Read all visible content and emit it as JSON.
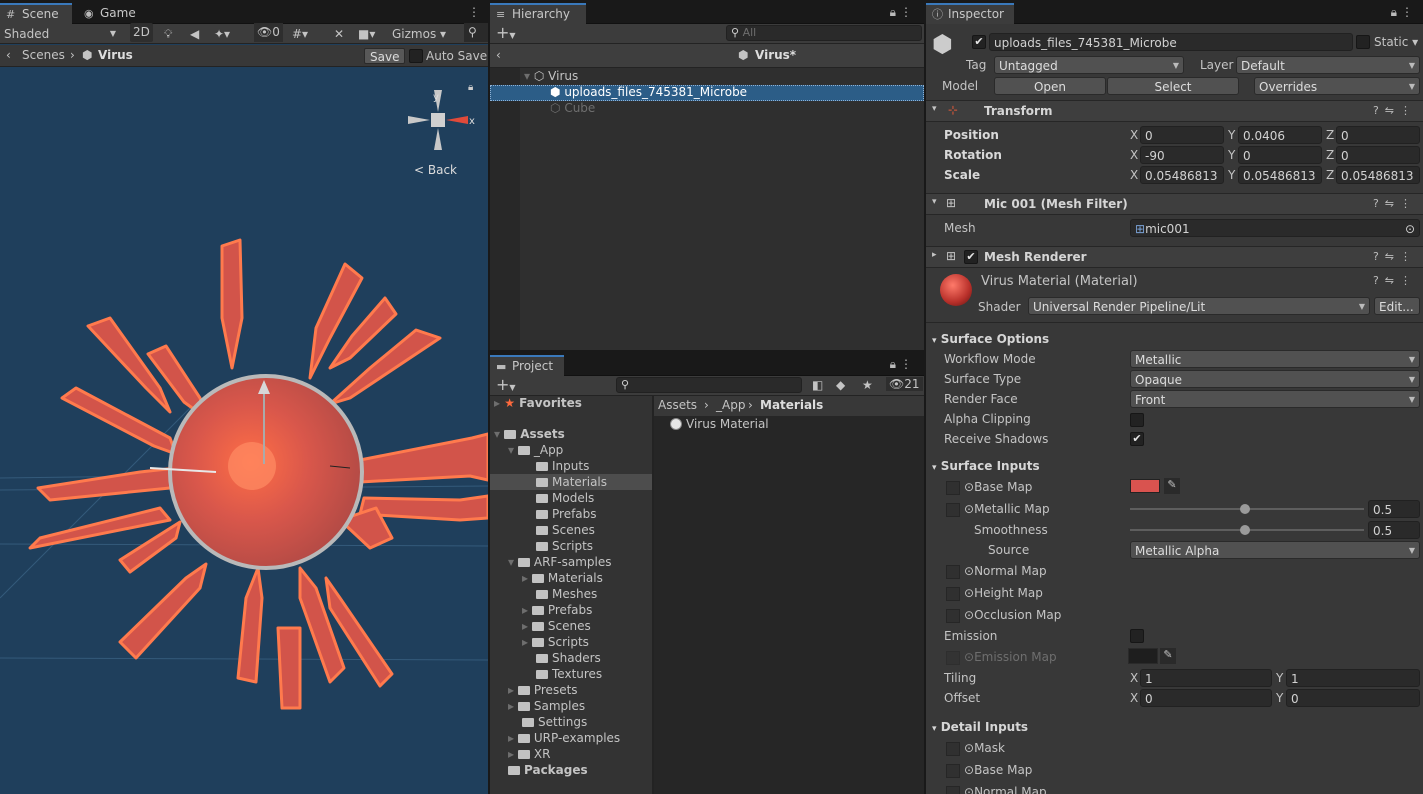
{
  "scene": {
    "tabs": [
      "Scene",
      "Game"
    ],
    "shading": "Shaded",
    "mode_2d": "2D",
    "hidden_count": "0",
    "gizmos": "Gizmos",
    "breadcrumb_root": "Scenes",
    "breadcrumb_current": "Virus",
    "save_label": "Save",
    "autosave_label": "Auto Save",
    "gizmo_back": "< Back",
    "axis_y": "y",
    "axis_x": "x",
    "colors": {
      "sky": "#1f3f5c",
      "virus": "#e2574c",
      "outline": "#ff6a3d"
    }
  },
  "hierarchy": {
    "tab": "Hierarchy",
    "add_label": "+",
    "search_placeholder": "All",
    "scene_title": "Virus*",
    "items": [
      {
        "label": "Virus"
      },
      {
        "label": "uploads_files_745381_Microbe"
      },
      {
        "label": "Cube"
      }
    ]
  },
  "project": {
    "tab": "Project",
    "hidden_count": "21",
    "favorites": "Favorites",
    "assets": "Assets",
    "tree": [
      {
        "label": "_App"
      },
      {
        "label": "Inputs"
      },
      {
        "label": "Materials"
      },
      {
        "label": "Models"
      },
      {
        "label": "Prefabs"
      },
      {
        "label": "Scenes"
      },
      {
        "label": "Scripts"
      },
      {
        "label": "ARF-samples"
      },
      {
        "label": "Materials"
      },
      {
        "label": "Meshes"
      },
      {
        "label": "Prefabs"
      },
      {
        "label": "Scenes"
      },
      {
        "label": "Scripts"
      },
      {
        "label": "Shaders"
      },
      {
        "label": "Textures"
      },
      {
        "label": "Presets"
      },
      {
        "label": "Samples"
      },
      {
        "label": "Settings"
      },
      {
        "label": "URP-examples"
      },
      {
        "label": "XR"
      }
    ],
    "packages": "Packages",
    "path": [
      "Assets",
      "_App",
      "Materials"
    ],
    "files": [
      {
        "label": "Virus Material"
      }
    ]
  },
  "inspector": {
    "tab": "Inspector",
    "object_name": "uploads_files_745381_Microbe",
    "static_label": "Static",
    "tag_label": "Tag",
    "tag_value": "Untagged",
    "layer_label": "Layer",
    "layer_value": "Default",
    "model_label": "Model",
    "open_label": "Open",
    "select_label": "Select",
    "overrides_label": "Overrides",
    "transform": {
      "title": "Transform",
      "position_label": "Position",
      "rotation_label": "Rotation",
      "scale_label": "Scale",
      "position": [
        "0",
        "0.0406",
        "0"
      ],
      "rotation": [
        "-90",
        "0",
        "0"
      ],
      "scale": [
        "0.05486813",
        "0.05486813",
        "0.05486813"
      ]
    },
    "mesh_filter": {
      "title": "Mic 001 (Mesh Filter)",
      "mesh_label": "Mesh",
      "mesh_value": "mic001"
    },
    "mesh_renderer": {
      "title": "Mesh Renderer"
    },
    "material": {
      "title": "Virus Material (Material)",
      "shader_label": "Shader",
      "shader_value": "Universal Render Pipeline/Lit",
      "edit_label": "Edit..."
    },
    "surface_options": {
      "title": "Surface Options",
      "workflow_label": "Workflow Mode",
      "workflow_value": "Metallic",
      "surface_type_label": "Surface Type",
      "surface_type_value": "Opaque",
      "render_face_label": "Render Face",
      "render_face_value": "Front",
      "alpha_clip_label": "Alpha Clipping",
      "receive_shadows_label": "Receive Shadows"
    },
    "surface_inputs": {
      "title": "Surface Inputs",
      "base_map": "Base Map",
      "metallic_map": "Metallic Map",
      "metallic_value": "0.5",
      "smoothness_label": "Smoothness",
      "smoothness_value": "0.5",
      "source_label": "Source",
      "source_value": "Metallic Alpha",
      "normal_map": "Normal Map",
      "height_map": "Height Map",
      "occlusion_map": "Occlusion Map",
      "emission_label": "Emission",
      "emission_map": "Emission Map",
      "tiling_label": "Tiling",
      "tiling": [
        "1",
        "1"
      ],
      "offset_label": "Offset",
      "offset": [
        "0",
        "0"
      ],
      "base_color": "#d9534f"
    },
    "detail_inputs": {
      "title": "Detail Inputs",
      "mask": "Mask",
      "base_map": "Base Map",
      "normal_map": "Normal Map"
    }
  }
}
